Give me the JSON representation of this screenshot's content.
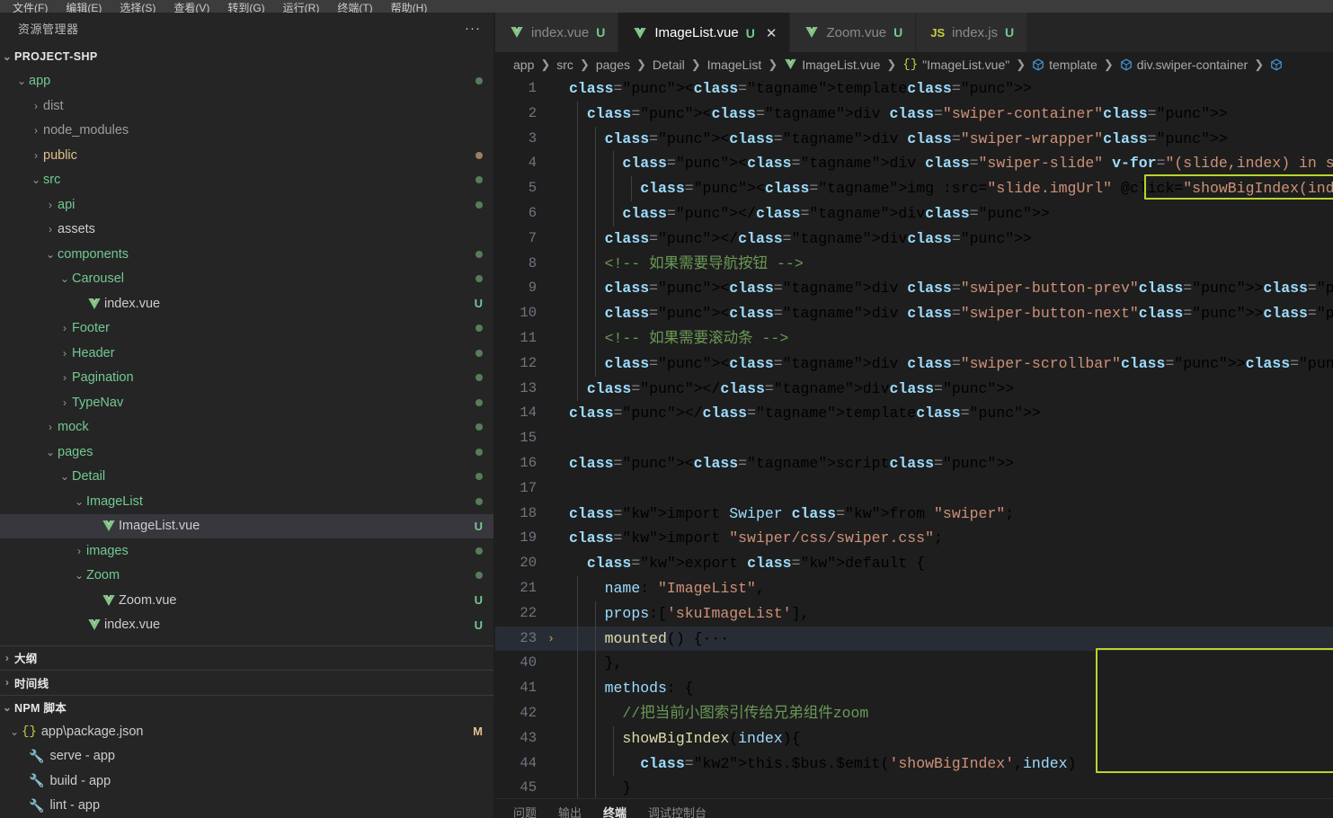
{
  "menubar": {
    "items": [
      "文件(F)",
      "编辑(E)",
      "选择(S)",
      "查看(V)",
      "转到(G)",
      "运行(R)",
      "终端(T)",
      "帮助(H)"
    ]
  },
  "sidebar": {
    "title": "资源管理器",
    "kebab": "···",
    "root": {
      "label": "PROJECT-SHP",
      "twisty": "⌄"
    },
    "tree": [
      {
        "label": "app",
        "indent": 1,
        "twisty": "open",
        "kind": "folder",
        "color": "green",
        "dot": "green"
      },
      {
        "label": "dist",
        "indent": 2,
        "twisty": "closed",
        "kind": "folder",
        "color": "dim",
        "dot": ""
      },
      {
        "label": "node_modules",
        "indent": 2,
        "twisty": "closed",
        "kind": "folder",
        "color": "dim",
        "dot": ""
      },
      {
        "label": "public",
        "indent": 2,
        "twisty": "closed",
        "kind": "folder",
        "color": "yellowish",
        "dot": "tan"
      },
      {
        "label": "src",
        "indent": 2,
        "twisty": "open",
        "kind": "folder",
        "color": "green",
        "dot": "green"
      },
      {
        "label": "api",
        "indent": 3,
        "twisty": "closed",
        "kind": "folder",
        "color": "green",
        "dot": "green"
      },
      {
        "label": "assets",
        "indent": 3,
        "twisty": "closed",
        "kind": "folder",
        "color": "plain",
        "dot": ""
      },
      {
        "label": "components",
        "indent": 3,
        "twisty": "open",
        "kind": "folder",
        "color": "green",
        "dot": "green"
      },
      {
        "label": "Carousel",
        "indent": 4,
        "twisty": "open",
        "kind": "folder",
        "color": "green",
        "dot": "green"
      },
      {
        "label": "index.vue",
        "indent": 5,
        "twisty": "none",
        "kind": "vue",
        "color": "plain",
        "badge": "U"
      },
      {
        "label": "Footer",
        "indent": 4,
        "twisty": "closed",
        "kind": "folder",
        "color": "green",
        "dot": "green"
      },
      {
        "label": "Header",
        "indent": 4,
        "twisty": "closed",
        "kind": "folder",
        "color": "green",
        "dot": "green"
      },
      {
        "label": "Pagination",
        "indent": 4,
        "twisty": "closed",
        "kind": "folder",
        "color": "green",
        "dot": "green"
      },
      {
        "label": "TypeNav",
        "indent": 4,
        "twisty": "closed",
        "kind": "folder",
        "color": "green",
        "dot": "green"
      },
      {
        "label": "mock",
        "indent": 3,
        "twisty": "closed",
        "kind": "folder",
        "color": "green",
        "dot": "green"
      },
      {
        "label": "pages",
        "indent": 3,
        "twisty": "open",
        "kind": "folder",
        "color": "green",
        "dot": "green"
      },
      {
        "label": "Detail",
        "indent": 4,
        "twisty": "open",
        "kind": "folder",
        "color": "green",
        "dot": "green"
      },
      {
        "label": "ImageList",
        "indent": 5,
        "twisty": "open",
        "kind": "folder",
        "color": "green",
        "dot": "green"
      },
      {
        "label": "ImageList.vue",
        "indent": 6,
        "twisty": "none",
        "kind": "vue",
        "color": "plain",
        "badge": "U",
        "selected": true
      },
      {
        "label": "images",
        "indent": 5,
        "twisty": "closed",
        "kind": "folder",
        "color": "green",
        "dot": "green"
      },
      {
        "label": "Zoom",
        "indent": 5,
        "twisty": "open",
        "kind": "folder",
        "color": "green",
        "dot": "green"
      },
      {
        "label": "Zoom.vue",
        "indent": 6,
        "twisty": "none",
        "kind": "vue",
        "color": "plain",
        "badge": "U"
      },
      {
        "label": "index.vue",
        "indent": 5,
        "twisty": "none",
        "kind": "vue",
        "color": "plain",
        "badge": "U"
      }
    ],
    "sections": [
      {
        "label": "大纲",
        "state": "closed"
      },
      {
        "label": "时间线",
        "state": "closed"
      },
      {
        "label": "NPM 脚本",
        "state": "open"
      }
    ],
    "npm": {
      "package": {
        "label": "app\\package.json",
        "badge": "M",
        "icon": "{}"
      },
      "scripts": [
        {
          "label": "serve - app"
        },
        {
          "label": "build - app"
        },
        {
          "label": "lint - app"
        }
      ]
    }
  },
  "tabs": [
    {
      "label": "index.vue",
      "icon": "vue-icon",
      "badge": "U",
      "active": false,
      "closable": false
    },
    {
      "label": "ImageList.vue",
      "icon": "vue-icon",
      "badge": "U",
      "active": true,
      "closable": true,
      "close": "✕"
    },
    {
      "label": "Zoom.vue",
      "icon": "vue-icon",
      "badge": "U",
      "active": false,
      "closable": false
    },
    {
      "label": "index.js",
      "icon": "js-icon",
      "badge": "U",
      "active": false,
      "closable": false
    }
  ],
  "breadcrumb": [
    {
      "label": "app",
      "icon": ""
    },
    {
      "label": "src",
      "icon": ""
    },
    {
      "label": "pages",
      "icon": ""
    },
    {
      "label": "Detail",
      "icon": ""
    },
    {
      "label": "ImageList",
      "icon": ""
    },
    {
      "label": "ImageList.vue",
      "icon": "vue-icon"
    },
    {
      "label": "\"ImageList.vue\"",
      "icon": "braces-icon"
    },
    {
      "label": "template",
      "icon": "cube-icon"
    },
    {
      "label": "div.swiper-container",
      "icon": "cube-icon"
    },
    {
      "label": "",
      "icon": "cube-icon"
    }
  ],
  "editor": {
    "lines": [
      {
        "num": "1",
        "fold": ""
      },
      {
        "num": "2",
        "fold": ""
      },
      {
        "num": "3",
        "fold": ""
      },
      {
        "num": "4",
        "fold": ""
      },
      {
        "num": "5",
        "fold": ""
      },
      {
        "num": "6",
        "fold": ""
      },
      {
        "num": "7",
        "fold": ""
      },
      {
        "num": "8",
        "fold": ""
      },
      {
        "num": "9",
        "fold": ""
      },
      {
        "num": "10",
        "fold": ""
      },
      {
        "num": "11",
        "fold": ""
      },
      {
        "num": "12",
        "fold": ""
      },
      {
        "num": "13",
        "fold": ""
      },
      {
        "num": "14",
        "fold": ""
      },
      {
        "num": "15",
        "fold": ""
      },
      {
        "num": "16",
        "fold": ""
      },
      {
        "num": "17",
        "fold": ""
      },
      {
        "num": "18",
        "fold": ""
      },
      {
        "num": "19",
        "fold": ""
      },
      {
        "num": "20",
        "fold": ""
      },
      {
        "num": "21",
        "fold": ""
      },
      {
        "num": "22",
        "fold": ""
      },
      {
        "num": "23",
        "fold": "›",
        "highlighted": true
      },
      {
        "num": "40",
        "fold": ""
      },
      {
        "num": "41",
        "fold": ""
      },
      {
        "num": "42",
        "fold": ""
      },
      {
        "num": "43",
        "fold": ""
      },
      {
        "num": "44",
        "fold": ""
      },
      {
        "num": "45",
        "fold": ""
      }
    ],
    "source": [
      "<template>",
      "  <div class=\"swiper-container\">",
      "    <div class=\"swiper-wrapper\">",
      "      <div class=\"swiper-slide\" v-for=\"(slide,index) in skuImageList\" :key=\"s",
      "        <img :src=\"slide.imgUrl\" @click=\"showBigIndex(index)\">",
      "      </div>",
      "    </div>",
      "    <!-- 如果需要导航按钮 -->",
      "    <div class=\"swiper-button-prev\"></div>",
      "    <div class=\"swiper-button-next\"></div>",
      "    <!-- 如果需要滚动条 -->",
      "    <div class=\"swiper-scrollbar\"></div>",
      "  </div>",
      "</template>",
      "",
      "<script>",
      "",
      "import Swiper from \"swiper\";",
      "import \"swiper/css/swiper.css\";",
      "  export default {",
      "    name: \"ImageList\",",
      "    props:['skuImageList'],",
      "    mounted() {···",
      "    },",
      "    methods: {",
      "      //把当前小图索引传给兄弟组件zoom",
      "      showBigIndex(index){",
      "        this.$bus.$emit('showBigIndex',index)",
      "      }"
    ],
    "highlight_boxes": [
      "line-5-img-tag",
      "lines-41-45-methods"
    ],
    "highlight_color": "#b9d42b"
  },
  "panel": {
    "tabs": [
      {
        "label": "问题",
        "active": false
      },
      {
        "label": "输出",
        "active": false
      },
      {
        "label": "终端",
        "active": true
      },
      {
        "label": "调试控制台",
        "active": false
      }
    ]
  }
}
